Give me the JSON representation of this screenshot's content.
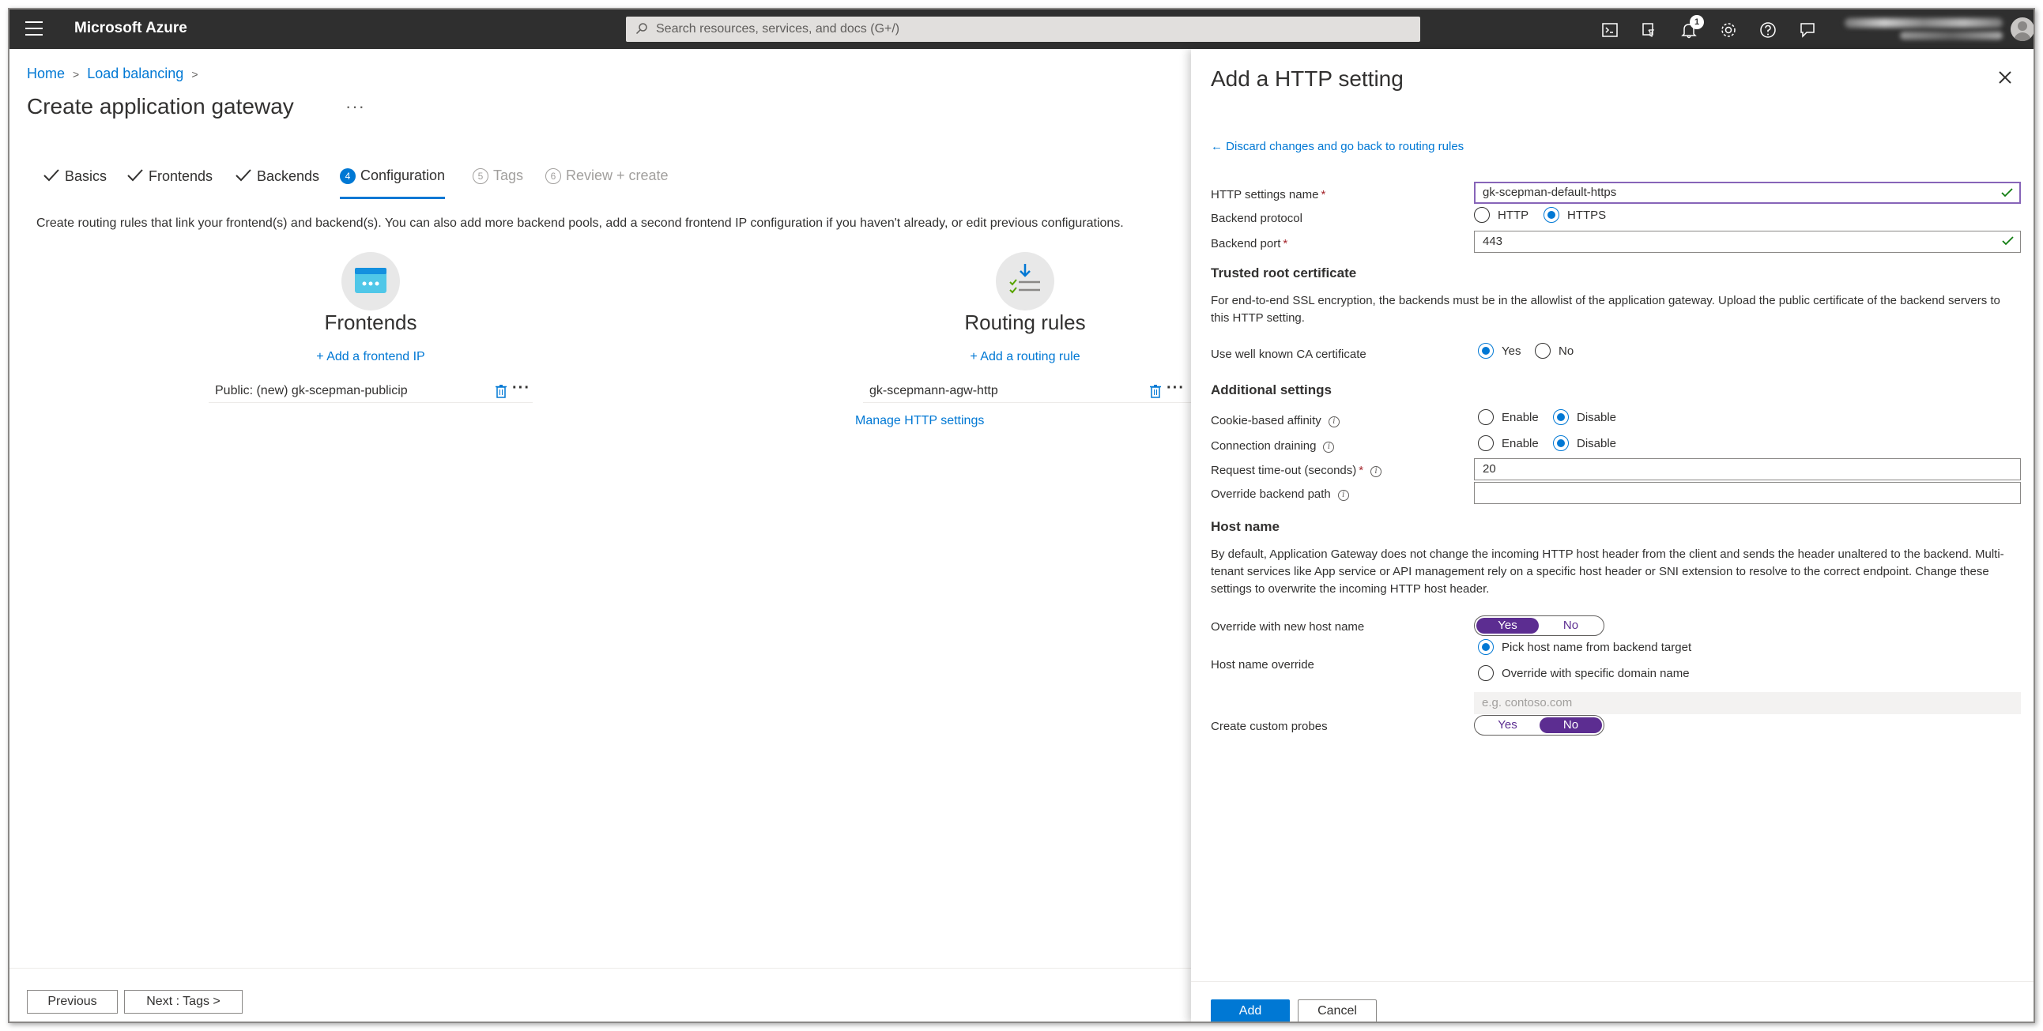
{
  "topbar": {
    "brand": "Microsoft Azure",
    "search_placeholder": "Search resources, services, and docs (G+/)",
    "notification_count": "1",
    "icons": [
      "cloud-shell-icon",
      "directory-filter-icon",
      "bell-icon",
      "gear-icon",
      "help-icon",
      "feedback-icon"
    ]
  },
  "breadcrumb": [
    "Home",
    "Load balancing"
  ],
  "page_title": "Create application gateway",
  "title_more": "···",
  "steps": [
    {
      "label": "Basics",
      "state": "done"
    },
    {
      "label": "Frontends",
      "state": "done"
    },
    {
      "label": "Backends",
      "state": "done"
    },
    {
      "num": "4",
      "label": "Configuration",
      "state": "active"
    },
    {
      "num": "5",
      "label": "Tags",
      "state": "disabled"
    },
    {
      "num": "6",
      "label": "Review + create",
      "state": "disabled"
    }
  ],
  "intro": "Create routing rules that link your frontend(s) and backend(s). You can also add more backend pools, add a second frontend IP configuration if you haven't already, or edit previous configurations.",
  "frontends": {
    "title": "Frontends",
    "add_link": "+ Add a frontend IP",
    "items": [
      "Public: (new) gk-scepman-publicip"
    ]
  },
  "routing": {
    "title": "Routing rules",
    "add_link": "+ Add a routing rule",
    "items": [
      "gk-scepmann-agw-http"
    ],
    "manage_link": "Manage HTTP settings"
  },
  "left_footer": {
    "previous": "Previous",
    "next": "Next : Tags >"
  },
  "panel": {
    "title": "Add a HTTP setting",
    "discard_link": "← Discard changes and go back to routing rules",
    "http_settings_name": {
      "label": "HTTP settings name",
      "value": "gk-scepman-default-https"
    },
    "backend_protocol": {
      "label": "Backend protocol",
      "options": [
        "HTTP",
        "HTTPS"
      ],
      "selected": "HTTPS"
    },
    "backend_port": {
      "label": "Backend port",
      "value": "443"
    },
    "trusted_root": {
      "heading": "Trusted root certificate",
      "text": "For end-to-end SSL encryption, the backends must be in the allowlist of the application gateway. Upload the public certificate of the backend servers to this HTTP setting.",
      "ca_label": "Use well known CA certificate",
      "ca_options": [
        "Yes",
        "No"
      ],
      "ca_selected": "Yes"
    },
    "additional": {
      "heading": "Additional settings",
      "cookie_label": "Cookie-based affinity",
      "cookie_options": [
        "Enable",
        "Disable"
      ],
      "cookie_selected": "Disable",
      "drain_label": "Connection draining",
      "drain_options": [
        "Enable",
        "Disable"
      ],
      "drain_selected": "Disable",
      "timeout_label": "Request time-out (seconds)",
      "timeout_value": "20",
      "override_path_label": "Override backend path",
      "override_path_value": ""
    },
    "host_name": {
      "heading": "Host name",
      "text": "By default, Application Gateway does not change the incoming HTTP host header from the client and sends the header unaltered to the backend. Multi-tenant services like App service or API management rely on a specific host header or SNI extension to resolve to the correct endpoint. Change these settings to overwrite the incoming HTTP host header.",
      "override_label": "Override with new host name",
      "override_toggle": {
        "yes": "Yes",
        "no": "No",
        "selected": "Yes"
      },
      "host_override_label": "Host name override",
      "host_override_options": [
        "Pick host name from backend target",
        "Override with specific domain name"
      ],
      "host_override_selected": "Pick host name from backend target",
      "domain_placeholder": "e.g. contoso.com",
      "probes_label": "Create custom probes",
      "probes_toggle": {
        "yes": "Yes",
        "no": "No",
        "selected": "No"
      }
    },
    "footer": {
      "add": "Add",
      "cancel": "Cancel"
    }
  },
  "colors": {
    "accent": "#0078d4",
    "toggle_on": "#5c2d91",
    "topbar": "#2f2f2f",
    "required": "#a4262c",
    "valid": "#107c10"
  }
}
